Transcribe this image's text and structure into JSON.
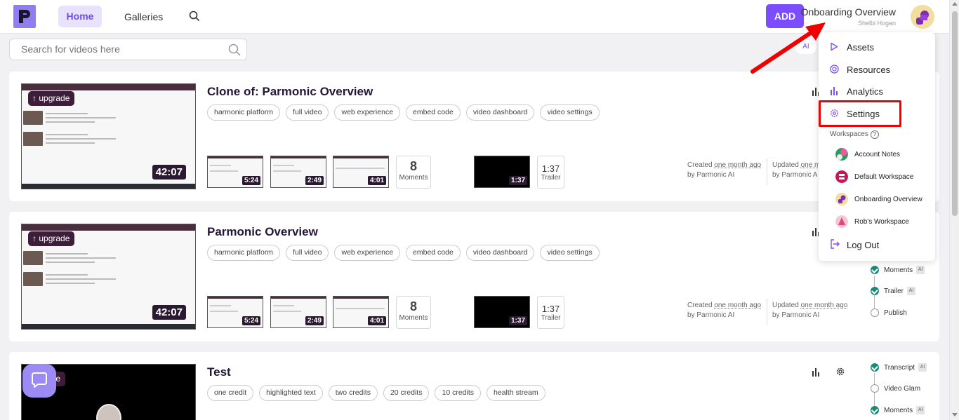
{
  "nav": {
    "home": "Home",
    "galleries": "Galleries",
    "add": "ADD",
    "workspace_title": "Onboarding Overview",
    "user_name": "Shelbi Hogan",
    "accent": "#7c4dff"
  },
  "search": {
    "placeholder": "Search for videos here",
    "value": "",
    "ai_pill": "AI"
  },
  "videos": [
    {
      "title": "Clone of: Parmonic Overview",
      "tags": [
        "harmonic platform",
        "full video",
        "web experience",
        "embed code",
        "video dashboard",
        "video settings"
      ],
      "upgrade": "upgrade",
      "duration": "42:07",
      "clips": [
        "5:24",
        "2:49",
        "4:01"
      ],
      "moments_count": "8",
      "moments_label": "Moments",
      "trailer_duration": "1:37",
      "trailer_box_time": "1:37",
      "trailer_label": "Trailer",
      "created_prefix": "Created",
      "created_when": "one month ago",
      "created_by": "by Parmonic AI",
      "updated_prefix": "Updated",
      "updated_when": "one m",
      "updated_by": "by Parmonic A"
    },
    {
      "title": "Parmonic Overview",
      "tags": [
        "harmonic platform",
        "full video",
        "web experience",
        "embed code",
        "video dashboard",
        "video settings"
      ],
      "upgrade": "upgrade",
      "duration": "42:07",
      "clips": [
        "5:24",
        "2:49",
        "4:01"
      ],
      "moments_count": "8",
      "moments_label": "Moments",
      "trailer_duration": "1:37",
      "trailer_box_time": "1:37",
      "trailer_label": "Trailer",
      "created_prefix": "Created",
      "created_when": "one month ago",
      "created_by": "by Parmonic AI",
      "updated_prefix": "Updated",
      "updated_when": "one month ago",
      "updated_by": "by Parmonic AI",
      "steps": [
        {
          "label": "Moments",
          "done": true,
          "ai": "AI"
        },
        {
          "label": "Trailer",
          "done": true,
          "ai": "AI"
        },
        {
          "label": "Publish",
          "done": false,
          "ai": ""
        }
      ]
    },
    {
      "title": "Test",
      "tags": [
        "one credit",
        "highlighted text",
        "two credits",
        "20 credits",
        "10 credits",
        "health stream"
      ],
      "upgrade": "grade",
      "steps": [
        {
          "label": "Transcript",
          "done": true,
          "ai": "AI"
        },
        {
          "label": "Video Glam",
          "done": false,
          "ai": ""
        },
        {
          "label": "Moments",
          "done": true,
          "ai": "AI"
        }
      ]
    }
  ],
  "dropdown": {
    "assets": "Assets",
    "resources": "Resources",
    "analytics": "Analytics",
    "settings": "Settings",
    "workspaces_label": "Workspaces",
    "workspaces_help": "?",
    "workspaces": [
      "Account Notes",
      "Default Workspace",
      "Onboarding Overview",
      "Rob's Workspace"
    ],
    "logout": "Log Out"
  }
}
